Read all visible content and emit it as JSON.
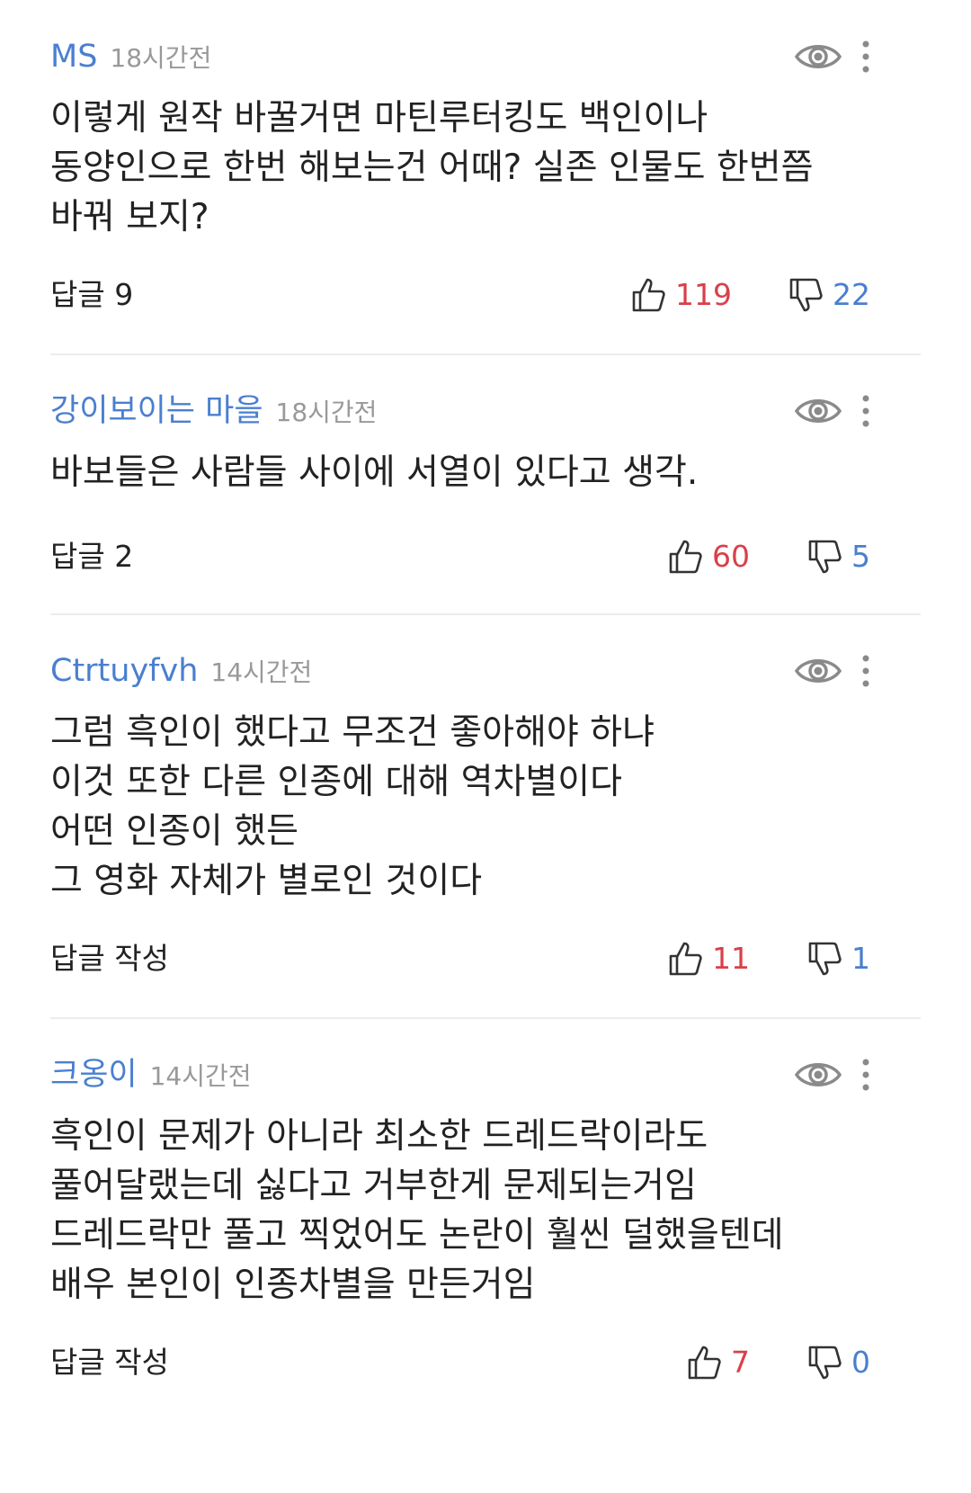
{
  "comments": [
    {
      "author": "MS",
      "time": "18시간전",
      "text": "이렇게 원작 바꿀거면 마틴루터킹도 백인이나\n동양인으로 한번 해보는건 어때? 실존 인물도 한번쯤\n바꿔 보지?",
      "reply": "답글 9",
      "likes": "119",
      "dislikes": "22"
    },
    {
      "author": "강이보이는 마을",
      "time": "18시간전",
      "text": "바보들은 사람들 사이에 서열이 있다고 생각.",
      "reply": "답글 2",
      "likes": "60",
      "dislikes": "5"
    },
    {
      "author": "Ctrtuyfvh",
      "time": "14시간전",
      "text": "그럼 흑인이 했다고 무조건 좋아해야 하냐\n이것 또한 다른 인종에 대해 역차별이다\n어떤 인종이 했든\n그 영화 자체가 별로인 것이다",
      "reply": "답글 작성",
      "likes": "11",
      "dislikes": "1"
    },
    {
      "author": "크옹이",
      "time": "14시간전",
      "text": "흑인이 문제가 아니라 최소한 드레드락이라도\n풀어달랬는데 싫다고 거부한게 문제되는거임\n드레드락만 풀고 찍었어도 논란이 훨씬 덜했을텐데\n배우 본인이 인종차별을 만든거임",
      "reply": "답글 작성",
      "likes": "7",
      "dislikes": "0"
    }
  ],
  "icons": {
    "eye": "eye-icon",
    "more": "more-vertical-icon",
    "like": "thumbs-up-icon",
    "dislike": "thumbs-down-icon"
  },
  "colors": {
    "author": "#4a7fd0",
    "like": "#d9404a",
    "dislike": "#4a7fd0",
    "timestamp": "#999999"
  }
}
